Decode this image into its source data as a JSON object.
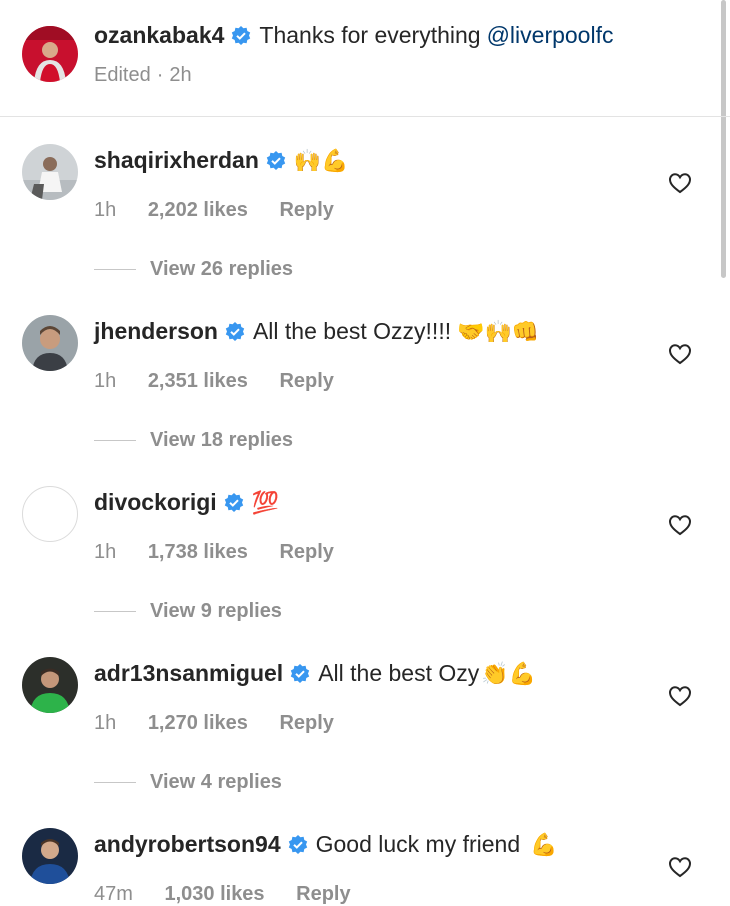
{
  "post": {
    "username": "ozankabak4",
    "caption": "Thanks for everything",
    "mention": "@liverpoolfc",
    "edited": "Edited",
    "time": "2h"
  },
  "comments": [
    {
      "username": "shaqirixherdan",
      "text": "",
      "emoji": "🙌💪",
      "time": "1h",
      "likes": "2,202 likes",
      "reply": "Reply",
      "view_replies": "View 26 replies"
    },
    {
      "username": "jhenderson",
      "text": "All the best Ozzy!!!!",
      "emoji": "🤝🙌👊",
      "time": "1h",
      "likes": "2,351 likes",
      "reply": "Reply",
      "view_replies": "View 18 replies"
    },
    {
      "username": "divockorigi",
      "text": "",
      "emoji": "💯",
      "time": "1h",
      "likes": "1,738 likes",
      "reply": "Reply",
      "view_replies": "View 9 replies"
    },
    {
      "username": "adr13nsanmiguel",
      "text": "All the best Ozy",
      "emoji": "👏💪",
      "time": "1h",
      "likes": "1,270 likes",
      "reply": "Reply",
      "view_replies": "View 4 replies"
    },
    {
      "username": "andyrobertson94",
      "text": "Good luck my friend",
      "emoji": "💪",
      "time": "47m",
      "likes": "1,030 likes",
      "reply": "Reply",
      "view_replies": ""
    }
  ],
  "colors": {
    "verified": "#3897f0",
    "muted": "#8e8e8e",
    "mention": "#00376b"
  }
}
